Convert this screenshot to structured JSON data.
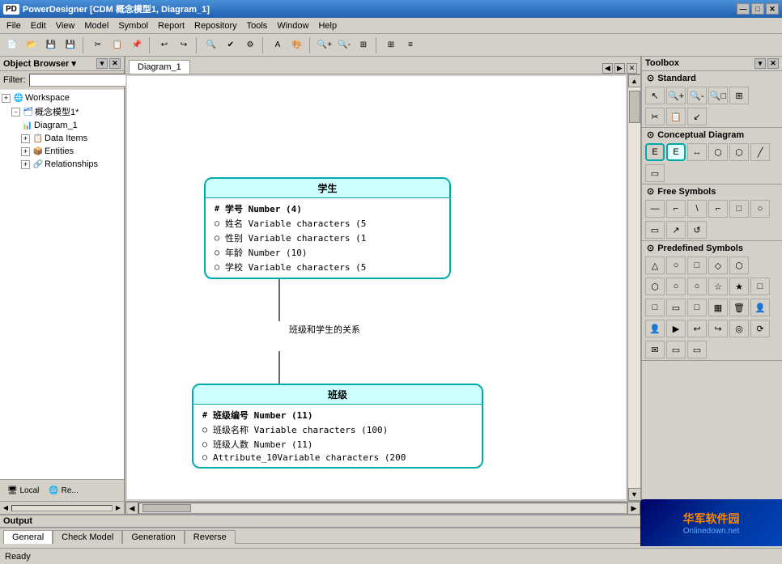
{
  "titlebar": {
    "title": "PowerDesigner [CDM 概念模型1, Diagram_1]",
    "icon": "PD",
    "min_btn": "—",
    "max_btn": "□",
    "close_btn": "✕"
  },
  "menubar": {
    "items": [
      "File",
      "Edit",
      "View",
      "Model",
      "Symbol",
      "Report",
      "Repository",
      "Tools",
      "Window",
      "Help"
    ]
  },
  "objectbrowser": {
    "title": "Object Browser ▾",
    "filter_label": "Filter:",
    "filter_value": "",
    "tree": {
      "workspace": "Workspace",
      "model": "概念模型1*",
      "diagram": "Diagram_1",
      "data_items": "Data Items",
      "entities": "Entities",
      "relationships": "Relationships"
    }
  },
  "diagram": {
    "tab_label": "Diagram_1",
    "entity1": {
      "title": "学生",
      "rows": [
        {
          "marker": "#",
          "text": "学号  Number (4)",
          "pk": true
        },
        {
          "marker": "○",
          "text": "姓名  Variable characters (5",
          "pk": false
        },
        {
          "marker": "○",
          "text": "性别  Variable characters (1",
          "pk": false
        },
        {
          "marker": "○",
          "text": "年龄  Number (10)",
          "pk": false
        },
        {
          "marker": "○",
          "text": "学校  Variable characters (5",
          "pk": false
        }
      ]
    },
    "relationship_label": "班级和学生的关系",
    "entity2": {
      "title": "班级",
      "rows": [
        {
          "marker": "#",
          "text": "班级编号    Number (11)",
          "pk": true
        },
        {
          "marker": "○",
          "text": "班级名称    Variable characters (100)",
          "pk": false
        },
        {
          "marker": "○",
          "text": "班级人数    Number (11)",
          "pk": false
        },
        {
          "marker": "○",
          "text": "Attribute_10Variable characters (200",
          "pk": false
        }
      ]
    }
  },
  "toolbox": {
    "title": "Toolbox",
    "sections": [
      {
        "label": "Standard",
        "rows": [
          [
            "⊞",
            "≡",
            "",
            "",
            "",
            "",
            "",
            "",
            ""
          ],
          [
            "✂",
            "📋",
            "↙",
            "",
            "",
            "",
            "",
            "",
            ""
          ],
          [
            "",
            "",
            "",
            "",
            "",
            "",
            "",
            "",
            ""
          ]
        ]
      },
      {
        "label": "Conceptual Diagram",
        "rows": [
          [
            "▭",
            "▭",
            "↔",
            "⬡",
            "⬡",
            ""
          ],
          [
            "",
            "",
            "",
            "",
            "",
            ""
          ]
        ]
      },
      {
        "label": "Free Symbols",
        "rows": [
          [
            "—",
            "⌐",
            "\\",
            "⌐",
            "□",
            "○"
          ],
          [
            "□",
            "↗",
            "↺",
            "",
            "",
            ""
          ]
        ]
      },
      {
        "label": "Predefined Symbols",
        "rows": [
          [
            "△",
            "○",
            "□",
            "◇",
            ""
          ],
          [
            "⬡",
            "○",
            "○",
            "☆",
            "★",
            "□"
          ],
          [
            "□",
            "▭",
            "□",
            "▦",
            "🗑",
            "👤"
          ],
          [
            "👤",
            "▶",
            "↩",
            "↪",
            "◎",
            "⟳"
          ],
          [
            "✉",
            "▭",
            "▭"
          ]
        ]
      }
    ]
  },
  "output": {
    "title": "Output"
  },
  "bottom_tabs": [
    "General",
    "Check Model",
    "Generation",
    "Reverse"
  ],
  "statusbar": {
    "text": "Ready"
  }
}
